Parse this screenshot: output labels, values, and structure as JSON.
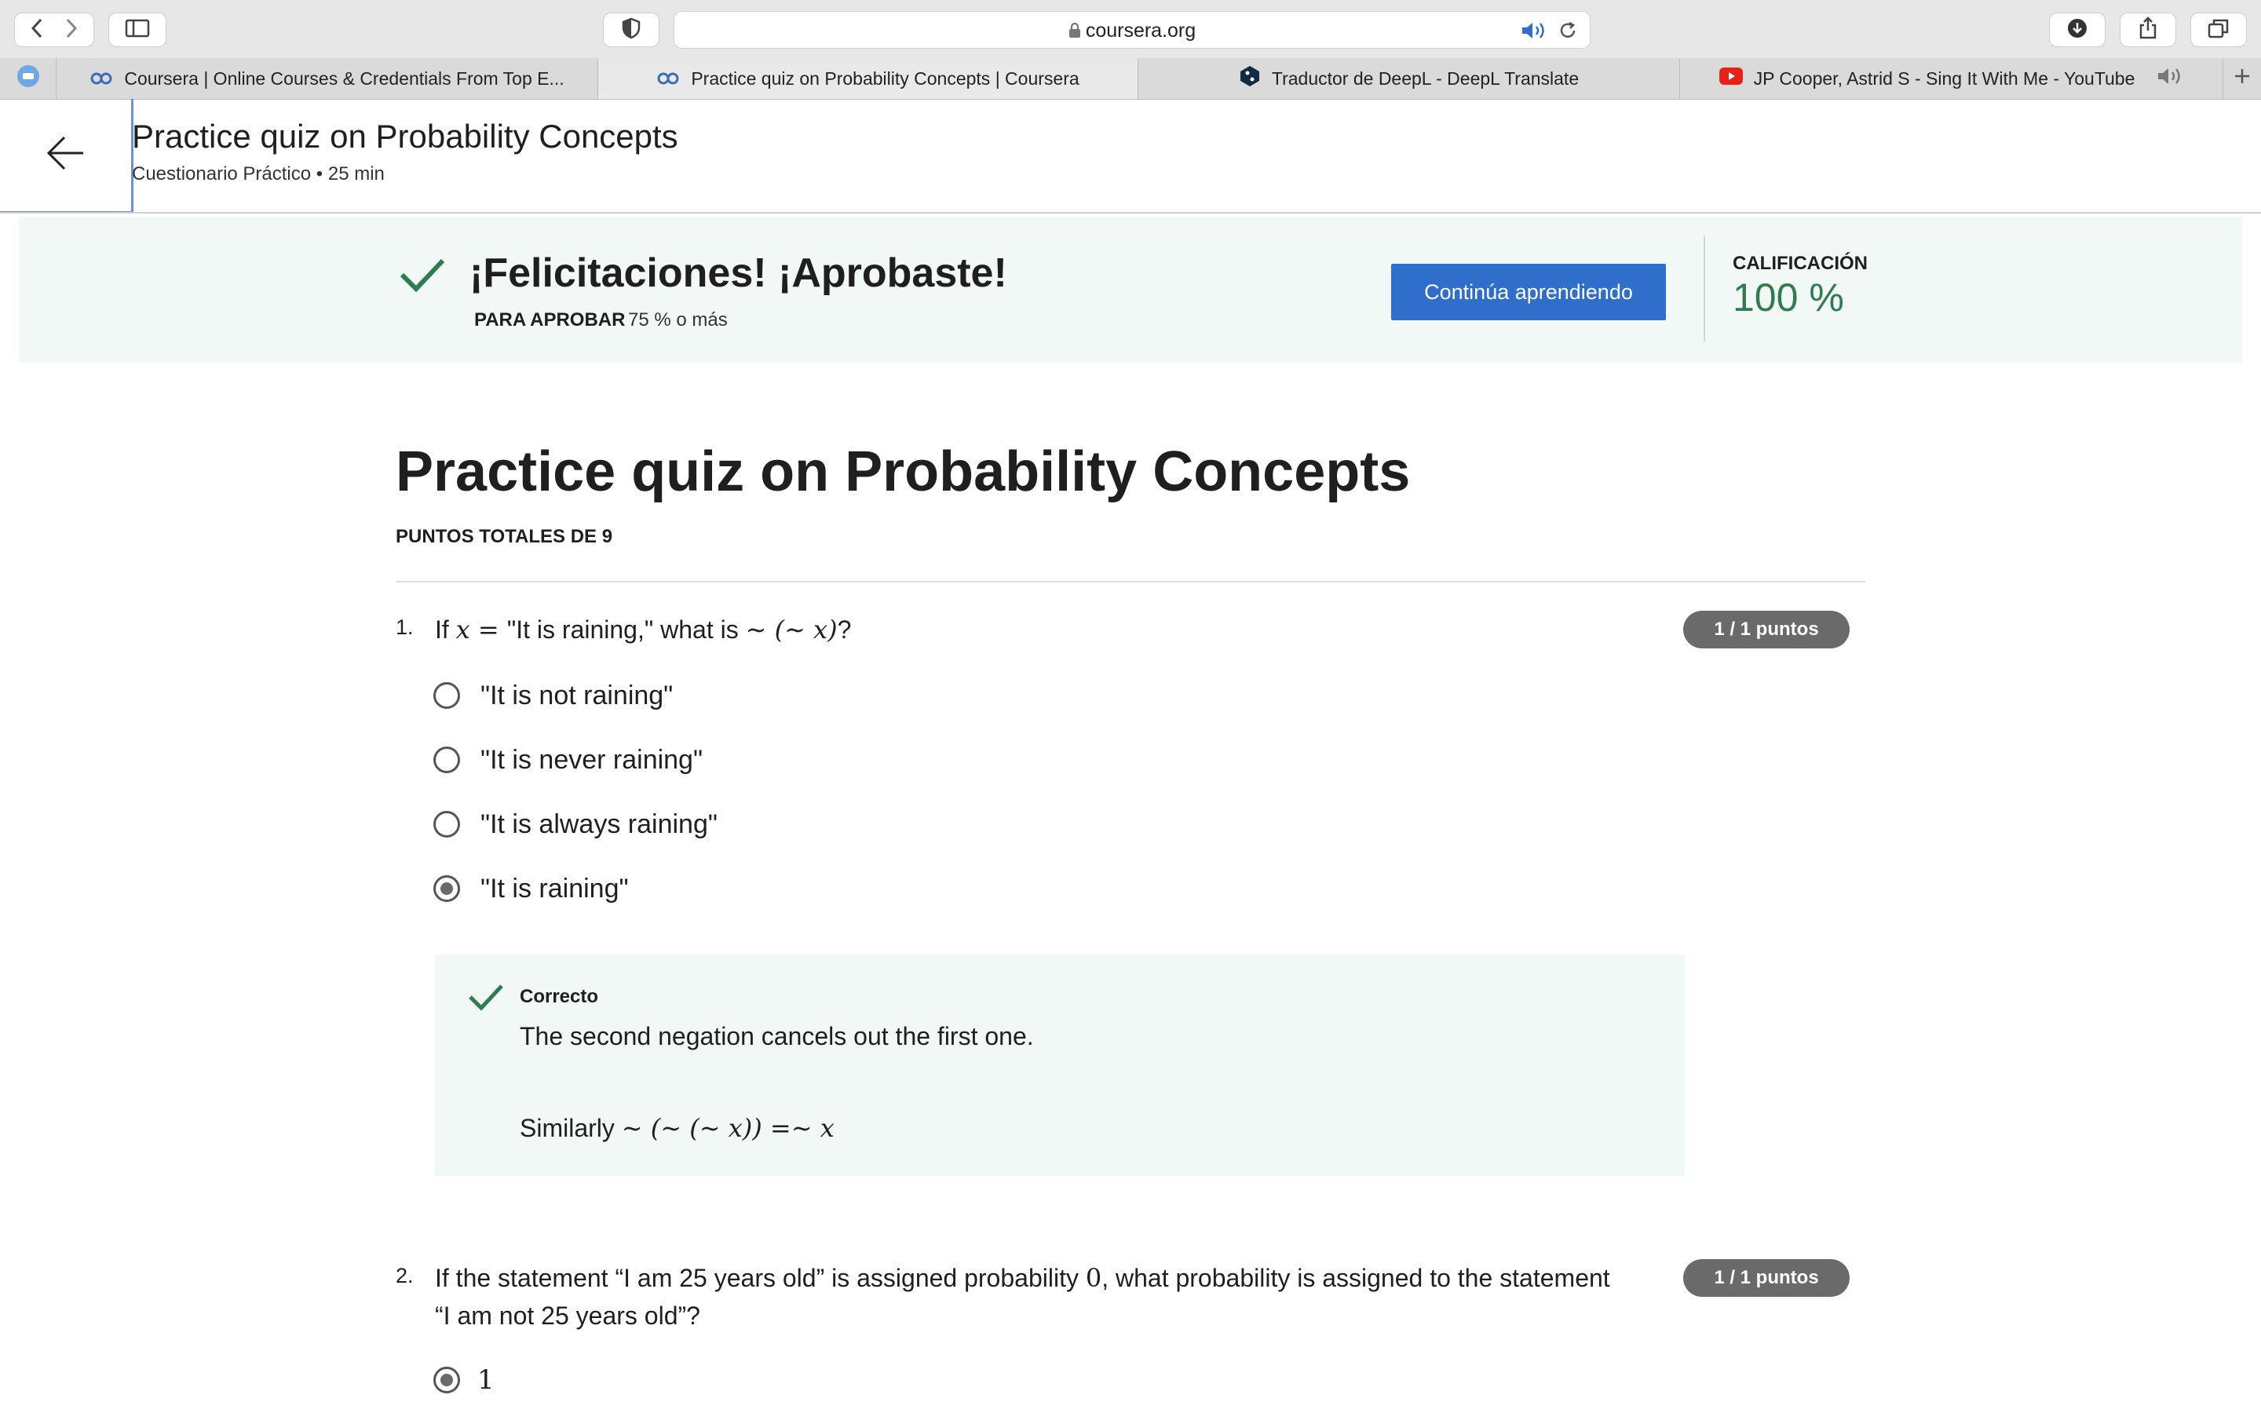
{
  "browser": {
    "url": "coursera.org",
    "tabs": [
      {
        "label": "Coursera | Online Courses & Credentials From Top E...",
        "icon": "coursera-icon"
      },
      {
        "label": "Practice quiz on Probability Concepts | Coursera",
        "icon": "coursera-icon",
        "active": true
      },
      {
        "label": "Traductor de DeepL - DeepL Translate",
        "icon": "deepl-icon"
      },
      {
        "label": "JP Cooper, Astrid S - Sing It With Me - YouTube",
        "icon": "youtube-icon"
      }
    ]
  },
  "header": {
    "title": "Practice quiz on Probability Concepts",
    "subtitle": "Cuestionario Práctico • 25 min"
  },
  "banner": {
    "heading": "¡Felicitaciones! ¡Aprobaste!",
    "pass_label": "PARA APROBAR",
    "pass_value": "75 % o más",
    "continue_button": "Continúa aprendiendo",
    "grade_label": "CALIFICACIÓN",
    "grade_value": "100 %"
  },
  "quiz": {
    "title": "Practice quiz on Probability Concepts",
    "total_points": "PUNTOS TOTALES DE 9",
    "questions": [
      {
        "number": "1.",
        "text_pre": "If ",
        "var_x": "x",
        "eq": " = ",
        "text_mid": "\"It is raining,\" what is ",
        "expr": "∼ (∼ x)",
        "text_post": "?",
        "points": "1 / 1 puntos",
        "options": [
          {
            "label": "\"It is not raining\"",
            "selected": false
          },
          {
            "label": "\"It is never raining\"",
            "selected": false
          },
          {
            "label": "\"It is always raining\"",
            "selected": false
          },
          {
            "label": "\"It is raining\"",
            "selected": true
          }
        ],
        "feedback": {
          "status": "Correcto",
          "line1": "The second negation cancels out the first one.",
          "line2_text": "Similarly ",
          "line2_math": "∼ (∼ (∼ x)) =∼ x"
        }
      },
      {
        "number": "2.",
        "text_a": "If the statement “I am 25 years old” is assigned probability ",
        "zero": "0",
        "text_b": ", what probability is assigned to the statement",
        "text_c": "“I am not 25 years old”?",
        "points": "1 / 1 puntos",
        "options": [
          {
            "label": "1",
            "selected": true
          }
        ]
      }
    ]
  },
  "colors": {
    "accent_blue": "#2f6fcb",
    "success_green": "#2e7d4f",
    "banner_bg": "#f2f8f5",
    "badge_gray": "#6a6a6a"
  }
}
